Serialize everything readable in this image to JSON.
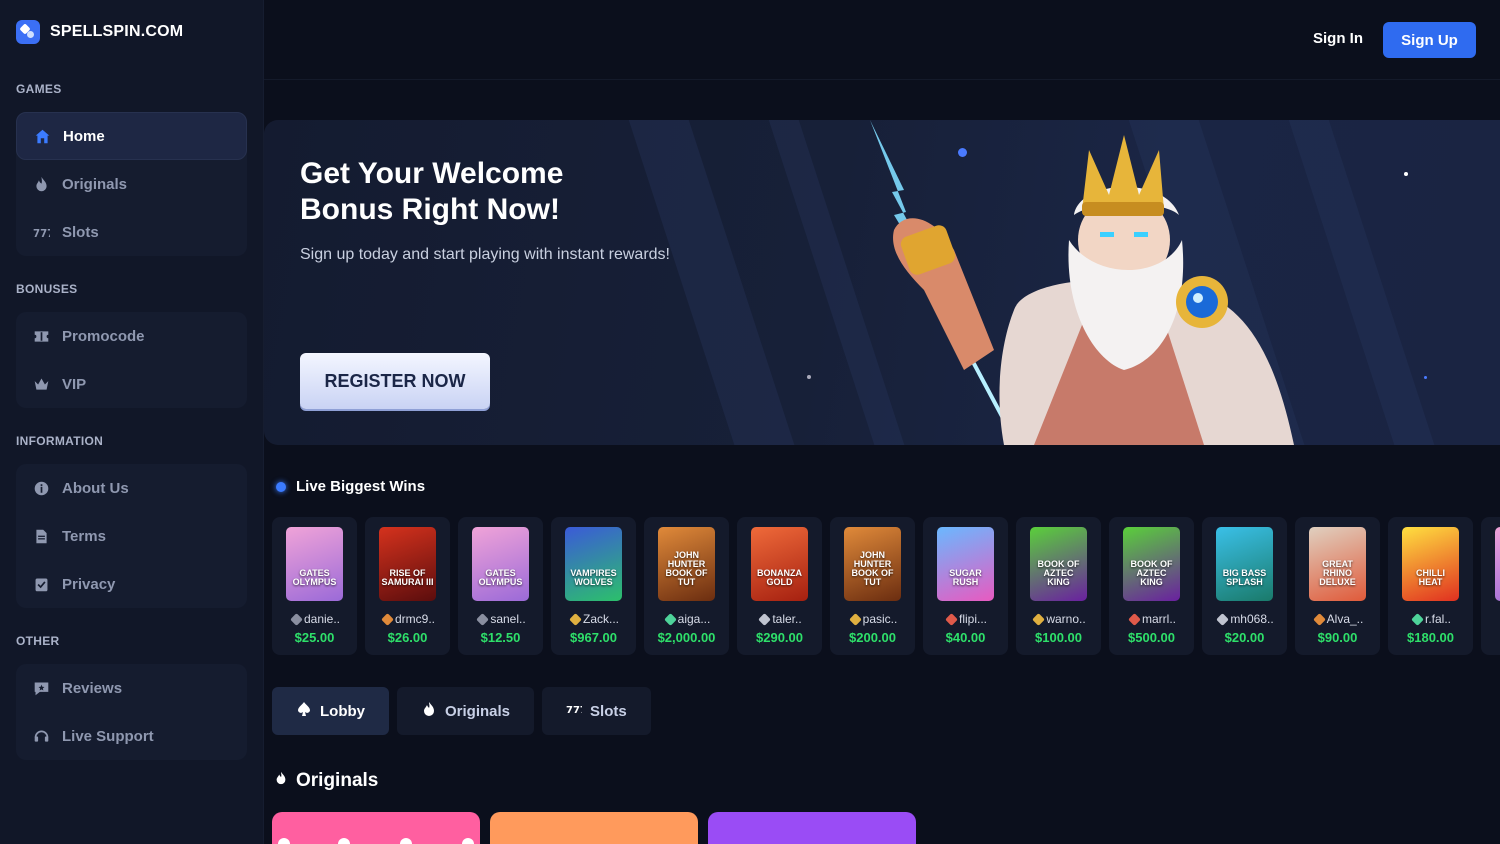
{
  "brand": {
    "name": "SPELLSPIN.COM"
  },
  "header": {
    "signin": "Sign In",
    "signup": "Sign Up"
  },
  "sidebar": {
    "sections": [
      {
        "title": "GAMES",
        "items": [
          {
            "label": "Home",
            "icon": "home-icon",
            "active": true
          },
          {
            "label": "Originals",
            "icon": "flame-icon"
          },
          {
            "label": "Slots",
            "icon": "slots-777-icon"
          }
        ]
      },
      {
        "title": "BONUSES",
        "items": [
          {
            "label": "Promocode",
            "icon": "ticket-icon"
          },
          {
            "label": "VIP",
            "icon": "crown-icon"
          }
        ]
      },
      {
        "title": "INFORMATION",
        "items": [
          {
            "label": "About Us",
            "icon": "info-icon"
          },
          {
            "label": "Terms",
            "icon": "document-icon"
          },
          {
            "label": "Privacy",
            "icon": "clipboard-check-icon"
          }
        ]
      },
      {
        "title": "OTHER",
        "items": [
          {
            "label": "Reviews",
            "icon": "review-chat-icon"
          },
          {
            "label": "Live Support",
            "icon": "headset-icon"
          }
        ]
      }
    ]
  },
  "banner": {
    "title": "Get Your Welcome\nBonus Right Now!",
    "subtitle": "Sign up today and start playing with instant rewards!",
    "cta": "REGISTER NOW"
  },
  "live": {
    "title": "Live Biggest Wins",
    "wins": [
      {
        "game": "GATES OLYMPUS",
        "user": "danie..",
        "amount": "$25.00",
        "colors": [
          "#f0a3d8",
          "#9b6ad8"
        ],
        "rank": "#8a8fa0"
      },
      {
        "game": "RISE OF SAMURAI III",
        "user": "drmc9..",
        "amount": "$26.00",
        "colors": [
          "#d5321d",
          "#5b0d0d"
        ],
        "rank": "#e08a3a"
      },
      {
        "game": "GATES OLYMPUS",
        "user": "sanel..",
        "amount": "$12.50",
        "colors": [
          "#f0a3d8",
          "#9b6ad8"
        ],
        "rank": "#8a8fa0"
      },
      {
        "game": "VAMPIRES WOLVES",
        "user": "Zack...",
        "amount": "$967.00",
        "colors": [
          "#3b5ad8",
          "#2cc06b"
        ],
        "rank": "#e0b040"
      },
      {
        "game": "JOHN HUNTER BOOK OF TUT",
        "user": "aiga...",
        "amount": "$2,000.00",
        "colors": [
          "#e08a3a",
          "#6b2d10"
        ],
        "rank": "#4ed39a"
      },
      {
        "game": "BONANZA GOLD",
        "user": "taler..",
        "amount": "$290.00",
        "colors": [
          "#ef6a3a",
          "#a52010"
        ],
        "rank": "#c0c4d0"
      },
      {
        "game": "JOHN HUNTER BOOK OF TUT",
        "user": "pasic..",
        "amount": "$200.00",
        "colors": [
          "#e08a3a",
          "#6b2d10"
        ],
        "rank": "#e0b040"
      },
      {
        "game": "SUGAR RUSH",
        "user": "flipi...",
        "amount": "$40.00",
        "colors": [
          "#6ab8ff",
          "#e85ac0"
        ],
        "rank": "#e05a4a"
      },
      {
        "game": "BOOK OF AZTEC KING",
        "user": "warno..",
        "amount": "$100.00",
        "colors": [
          "#5ad03a",
          "#6a20a0"
        ],
        "rank": "#e0b040"
      },
      {
        "game": "BOOK OF AZTEC KING",
        "user": "marrl..",
        "amount": "$500.00",
        "colors": [
          "#5ad03a",
          "#6a20a0"
        ],
        "rank": "#e05a4a"
      },
      {
        "game": "BIG BASS SPLASH",
        "user": "mh068..",
        "amount": "$20.00",
        "colors": [
          "#3ac0e8",
          "#1a7a6a"
        ],
        "rank": "#c0c4d0"
      },
      {
        "game": "GREAT RHINO DELUXE",
        "user": "Alva_..",
        "amount": "$90.00",
        "colors": [
          "#e0d0c0",
          "#e05a3a"
        ],
        "rank": "#e08a3a"
      },
      {
        "game": "CHILLI HEAT",
        "user": "r.fal..",
        "amount": "$180.00",
        "colors": [
          "#ffe040",
          "#e03020"
        ],
        "rank": "#4ed39a"
      }
    ]
  },
  "tabs": [
    {
      "label": "Lobby",
      "icon": "spade-icon",
      "active": true
    },
    {
      "label": "Originals",
      "icon": "flame-icon"
    },
    {
      "label": "Slots",
      "icon": "slots-777-icon"
    }
  ],
  "originals": {
    "title": "Originals",
    "card_colors": [
      "#ff5fa0",
      "#ff9a5c",
      "#9a4cf5"
    ]
  }
}
